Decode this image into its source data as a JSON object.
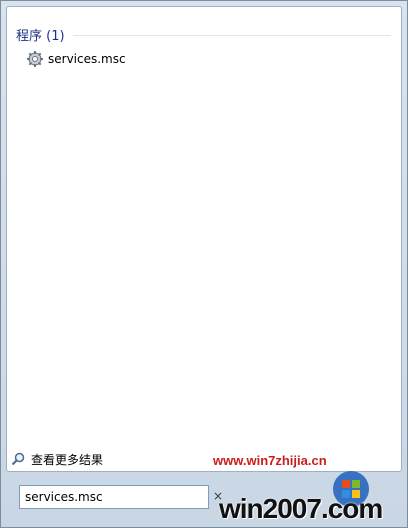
{
  "results": {
    "group_title": "程序 (1)",
    "items": [
      {
        "label": "services.msc",
        "icon": "gear-icon"
      }
    ]
  },
  "footer": {
    "see_more_label": "查看更多结果",
    "see_more_icon": "magnifier-icon"
  },
  "search": {
    "value": "services.msc",
    "clear_icon": "×"
  },
  "watermark": {
    "url": "www.win7zhijia.cn",
    "logo_text": "win2007.com"
  },
  "colors": {
    "group_title": "#1e3287",
    "watermark_red": "#c81e1e",
    "logo_blue": "#1d5fb8"
  }
}
